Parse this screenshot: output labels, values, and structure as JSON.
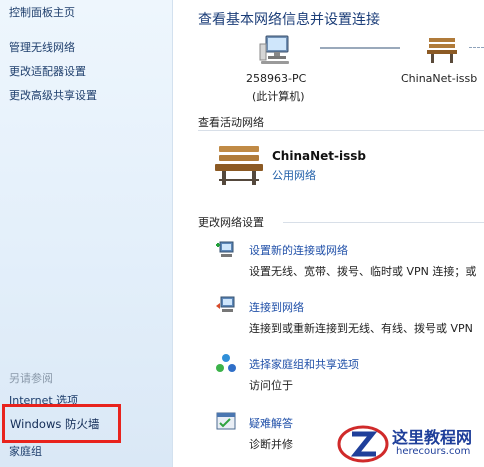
{
  "sidebar": {
    "home": "控制面板主页",
    "links": [
      "管理无线网络",
      "更改适配器设置",
      "更改高级共享设置"
    ],
    "see_also_heading": "另请参阅",
    "internet_options": "Internet 选项",
    "firewall": "Windows 防火墙",
    "homegroup": "家庭组"
  },
  "main": {
    "title": "查看基本网络信息并设置连接",
    "map": {
      "computer_name": "258963-PC",
      "computer_note": "(此计算机)",
      "network_name": "ChinaNet-issb"
    },
    "active_networks": {
      "heading": "查看活动网络",
      "name": "ChinaNet-issb",
      "type": "公用网络"
    },
    "change_settings": {
      "heading": "更改网络设置",
      "tasks": [
        {
          "link": "设置新的连接或网络",
          "desc": "设置无线、宽带、拨号、临时或 VPN 连接；或"
        },
        {
          "link": "连接到网络",
          "desc": "连接到或重新连接到无线、有线、拨号或 VPN"
        },
        {
          "link": "选择家庭组和共享选项",
          "desc": "访问位于"
        },
        {
          "link": "疑难解答",
          "desc": "诊断并修"
        }
      ]
    }
  },
  "watermark": {
    "title": "这里教程网",
    "url": "herecours.com"
  },
  "colors": {
    "highlight_border": "#e8231d",
    "link": "#1f4fa8",
    "title": "#1b3d78"
  }
}
